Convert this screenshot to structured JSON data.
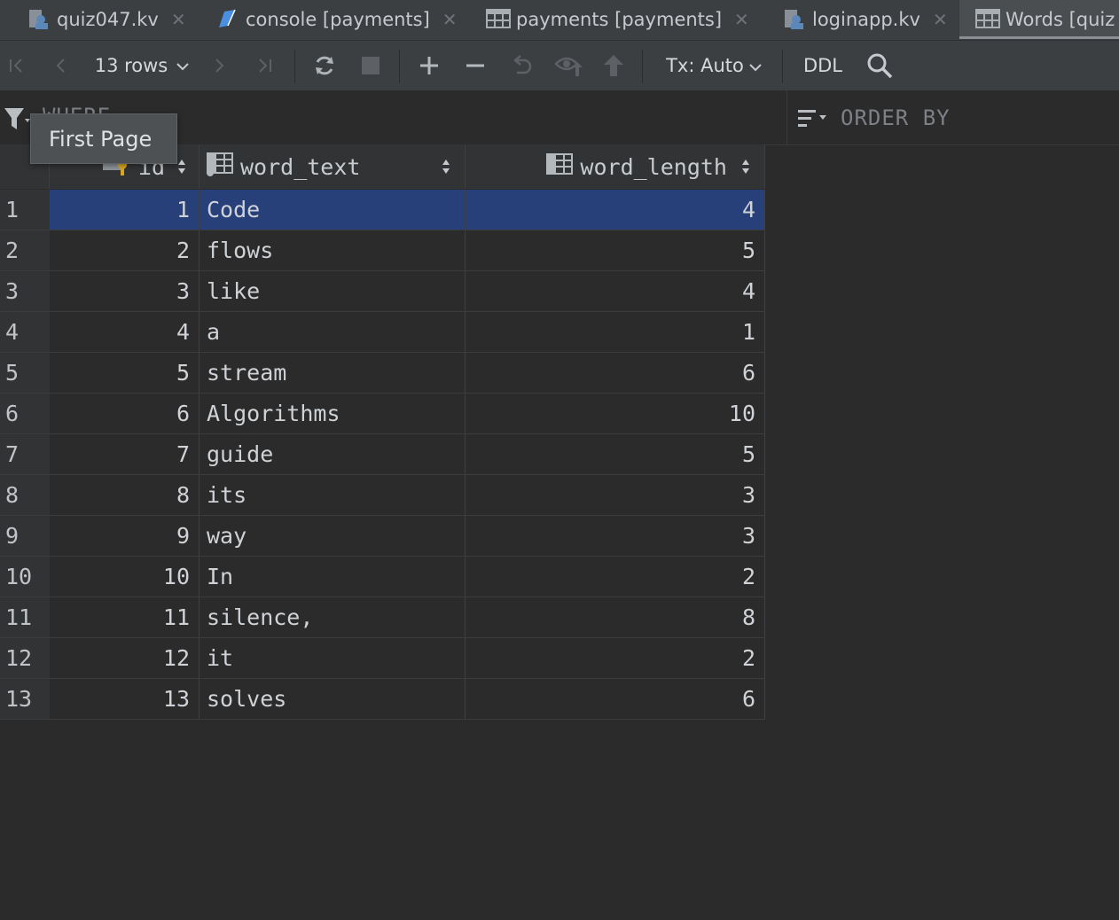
{
  "tabs": [
    {
      "label": "quiz047.kv",
      "icon": "kv-file-icon",
      "closable": true
    },
    {
      "label": "console [payments]",
      "icon": "console-icon",
      "closable": true
    },
    {
      "label": "payments [payments]",
      "icon": "table-icon",
      "closable": true
    },
    {
      "label": "loginapp.kv",
      "icon": "kv-file-icon",
      "closable": true
    },
    {
      "label": "Words [quiz",
      "icon": "table-icon",
      "active": true
    }
  ],
  "toolbar": {
    "rows_label": "13 rows",
    "tx_label": "Tx: Auto",
    "ddl_label": "DDL"
  },
  "filter": {
    "where_label": "WHERE",
    "order_label": "ORDER BY"
  },
  "tooltip": {
    "text": "First Page"
  },
  "columns": [
    {
      "name": "id",
      "icon": "primary-key-column-icon"
    },
    {
      "name": "word_text",
      "icon": "column-icon"
    },
    {
      "name": "word_length",
      "icon": "column-icon"
    }
  ],
  "rows": [
    {
      "num": "1",
      "id": "1",
      "word_text": "Code",
      "word_length": "4",
      "selected": true
    },
    {
      "num": "2",
      "id": "2",
      "word_text": "flows",
      "word_length": "5"
    },
    {
      "num": "3",
      "id": "3",
      "word_text": "like",
      "word_length": "4"
    },
    {
      "num": "4",
      "id": "4",
      "word_text": "a",
      "word_length": "1"
    },
    {
      "num": "5",
      "id": "5",
      "word_text": "stream",
      "word_length": "6"
    },
    {
      "num": "6",
      "id": "6",
      "word_text": "Algorithms",
      "word_length": "10"
    },
    {
      "num": "7",
      "id": "7",
      "word_text": "guide",
      "word_length": "5"
    },
    {
      "num": "8",
      "id": "8",
      "word_text": "its",
      "word_length": "3"
    },
    {
      "num": "9",
      "id": "9",
      "word_text": "way",
      "word_length": "3"
    },
    {
      "num": "10",
      "id": "10",
      "word_text": "In",
      "word_length": "2"
    },
    {
      "num": "11",
      "id": "11",
      "word_text": "silence,",
      "word_length": "8"
    },
    {
      "num": "12",
      "id": "12",
      "word_text": "it",
      "word_length": "2"
    },
    {
      "num": "13",
      "id": "13",
      "word_text": "solves",
      "word_length": "6"
    }
  ],
  "colors": {
    "selection": "#27407a",
    "background": "#2b2b2b",
    "toolbar": "#3c3f41"
  }
}
